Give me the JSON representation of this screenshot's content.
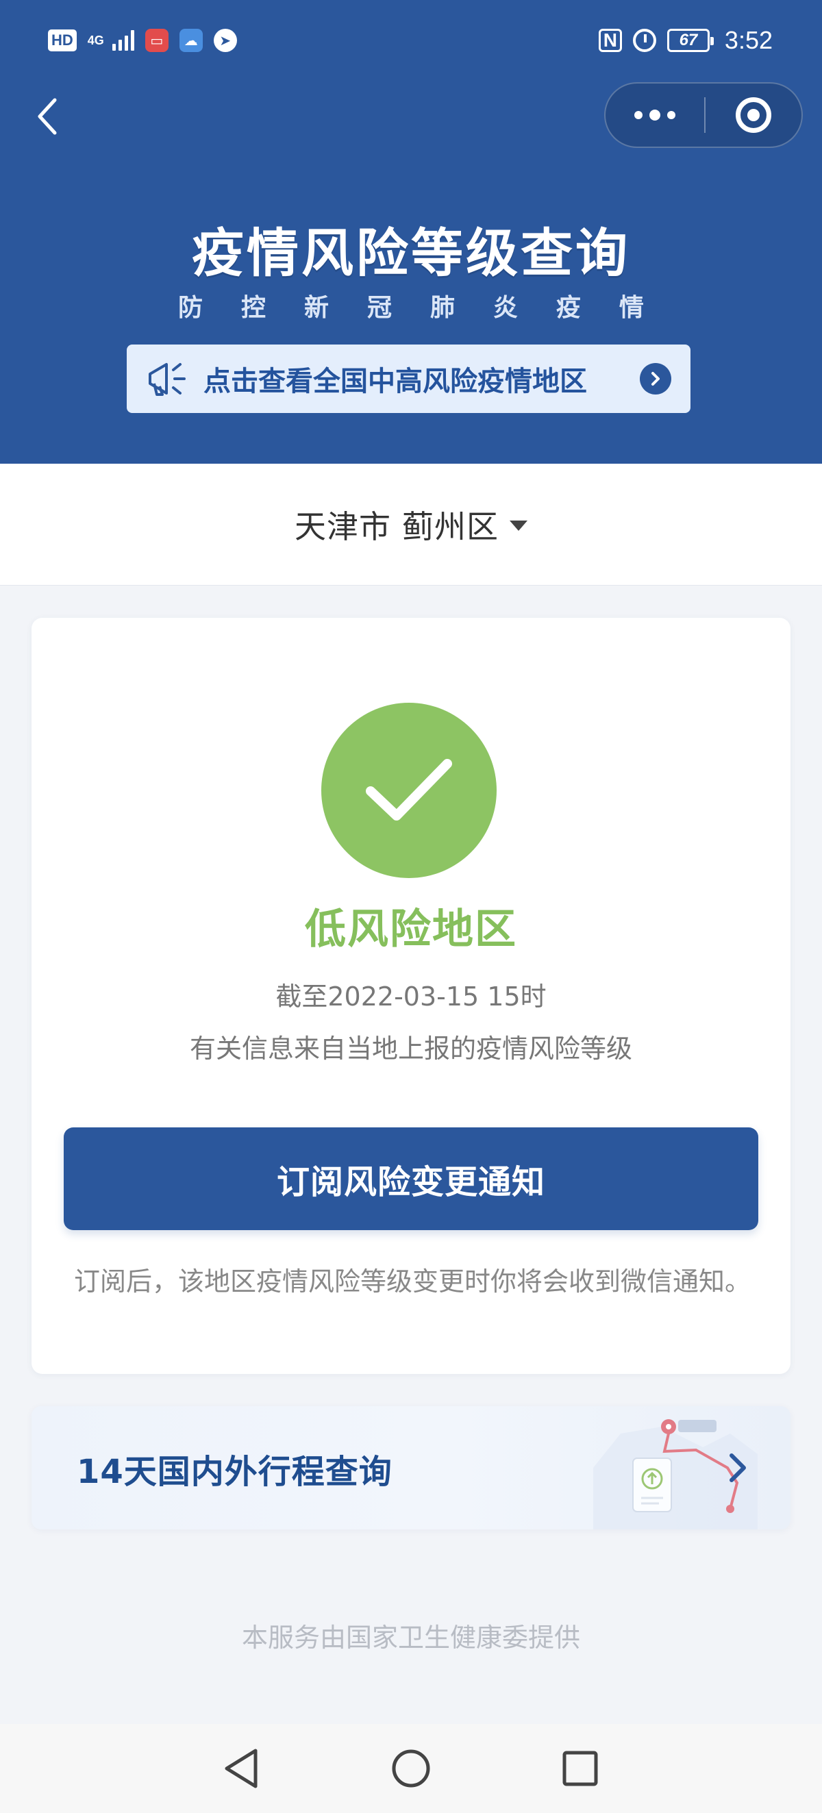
{
  "status_bar": {
    "hd": "HD",
    "network": "4G",
    "battery": "67",
    "time": "3:52"
  },
  "header": {
    "title": "疫情风险等级查询",
    "subtitle_chars": [
      "防",
      "控",
      "新",
      "冠",
      "肺",
      "炎",
      "疫",
      "情"
    ],
    "notice": "点击查看全国中高风险疫情地区"
  },
  "location": {
    "city": "天津市",
    "district": "蓟州区"
  },
  "risk_card": {
    "level": "低风险地区",
    "level_color": "#86bf5c",
    "updated": "截至2022-03-15 15时",
    "source": "有关信息来自当地上报的疫情风险等级",
    "subscribe_button": "订阅风险变更通知",
    "subscribe_note": "订阅后，该地区疫情风险等级变更时你将会收到微信通知。"
  },
  "travel_card": {
    "title": "14天国内外行程查询"
  },
  "footer": {
    "provider": "本服务由国家卫生健康委提供"
  },
  "colors": {
    "brand": "#2b579c",
    "success": "#8dc463"
  },
  "icons": {
    "back": "chevron-left-icon",
    "more": "more-dots-icon",
    "close": "miniprogram-close-icon",
    "megaphone": "megaphone-icon",
    "notice_arrow": "chevron-right-circle-icon",
    "dropdown": "caret-down-icon",
    "risk": "check-icon",
    "travel_arrow": "chevron-right-icon"
  }
}
